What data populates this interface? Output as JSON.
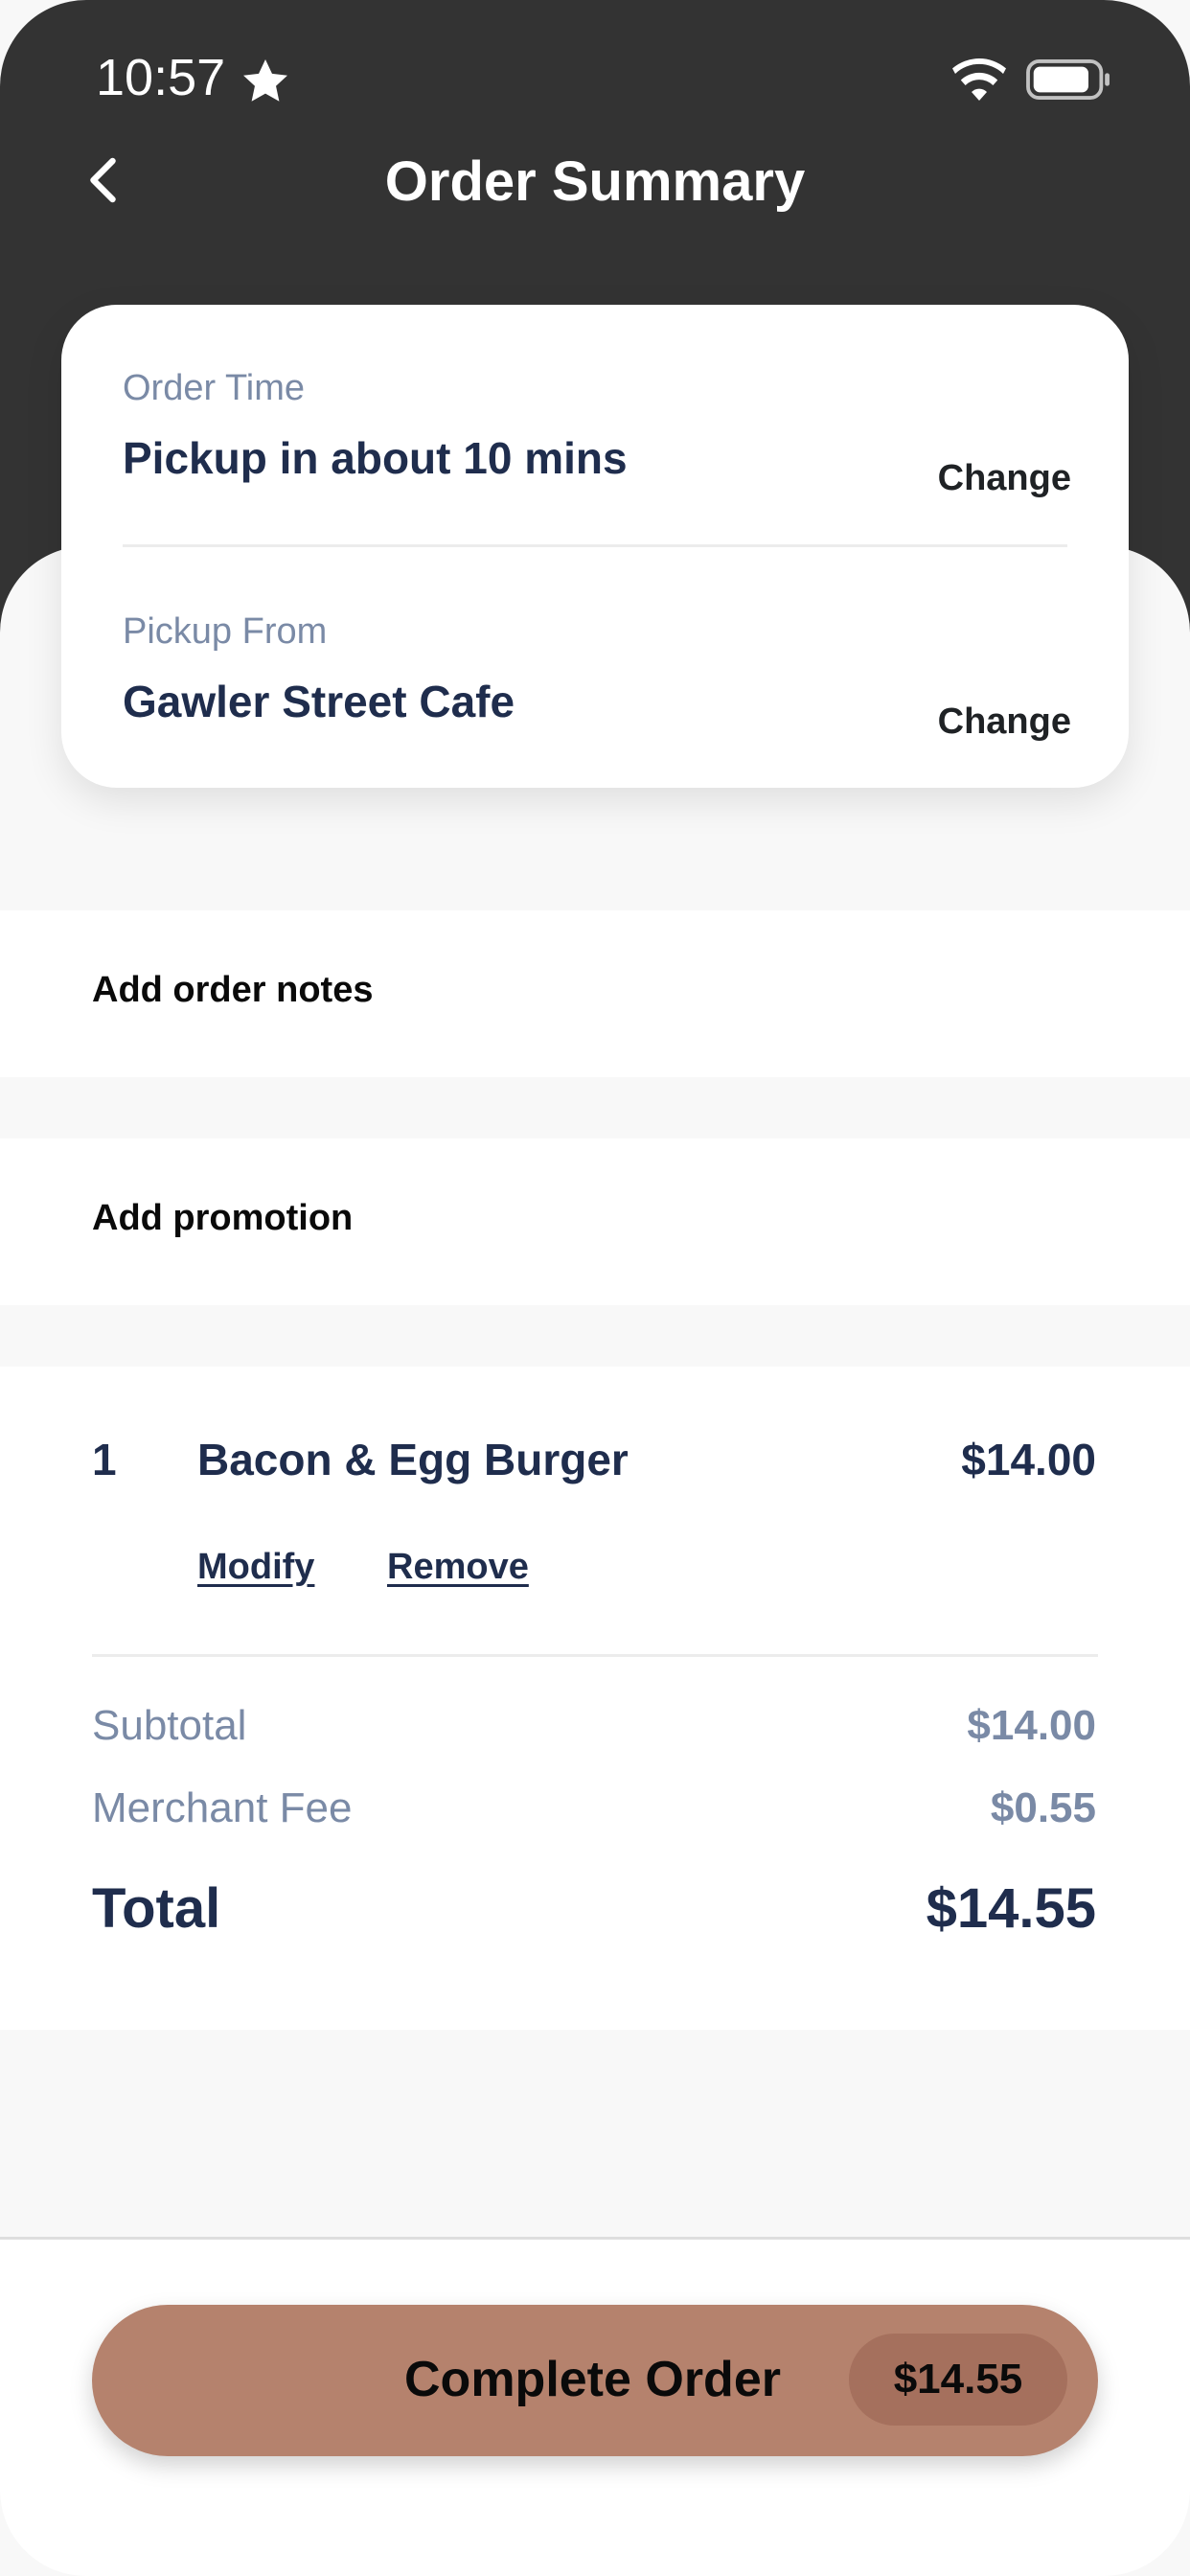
{
  "status_bar": {
    "time": "10:57"
  },
  "nav": {
    "title": "Order Summary"
  },
  "order_card": {
    "order_time_label": "Order Time",
    "order_time_value": "Pickup in about 10 mins",
    "pickup_from_label": "Pickup From",
    "pickup_from_value": "Gawler Street Cafe",
    "change_label": "Change"
  },
  "sections": {
    "notes_label": "Add order notes",
    "promo_label": "Add promotion"
  },
  "items": [
    {
      "qty": "1",
      "name": "Bacon & Egg Burger",
      "price": "$14.00",
      "modify_label": "Modify",
      "remove_label": "Remove"
    }
  ],
  "summary": {
    "subtotal_label": "Subtotal",
    "subtotal_value": "$14.00",
    "fee_label": "Merchant Fee",
    "fee_value": "$0.55",
    "total_label": "Total",
    "total_value": "$14.55"
  },
  "footer": {
    "complete_label": "Complete Order",
    "complete_price": "$14.55"
  },
  "colors": {
    "header_bg": "#333333",
    "navy_text": "#1f2d4d",
    "muted_text": "#7a8aa6",
    "cta_bg": "#b5826d",
    "cta_pill": "#a5705d"
  }
}
